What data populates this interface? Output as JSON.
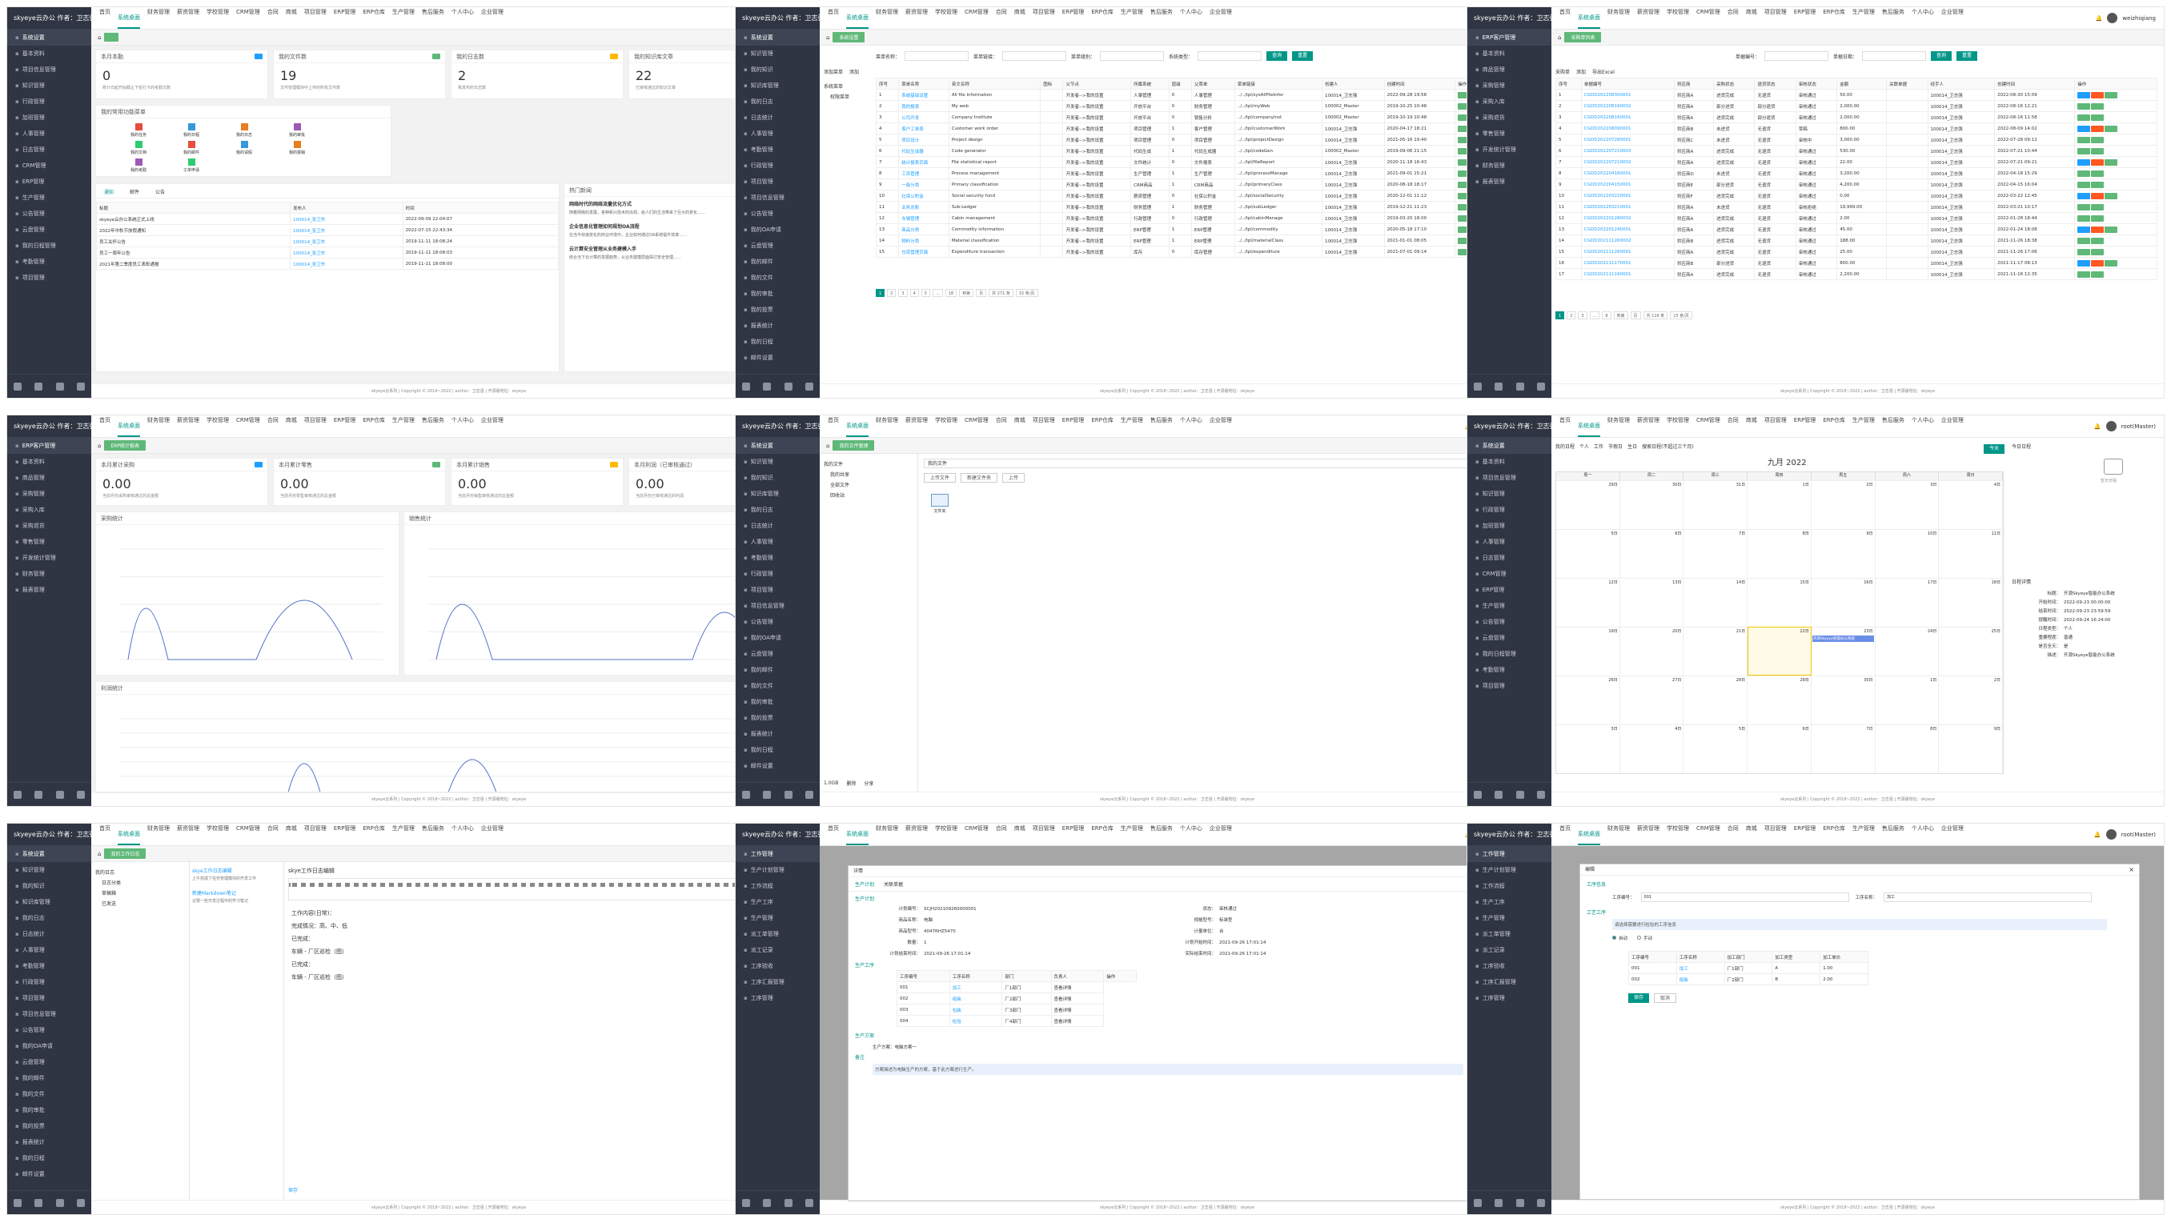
{
  "app": {
    "logo": "skyeye云办公 作者：卫志强",
    "username": "weizhiqiang",
    "username2": "root(Master)",
    "footer": "skyeye云系列 | Copyright © 2018~2022 | author：卫志强 | 开源版地址：skyeye"
  },
  "sidebar_nav": [
    "系统设置",
    "基本资料",
    "项目信息管理",
    "知识管理",
    "行政管理",
    "加班管理",
    "人事管理",
    "日志管理",
    "CRM管理",
    "ERP管理",
    "生产管理",
    "公告管理",
    "云盘管理",
    "我的日程管理",
    "考勤管理",
    "项目管理"
  ],
  "sidebar_erp": [
    "ERP客户管理",
    "基本资料",
    "商品管理",
    "采购管理",
    "采购入库",
    "采购退货",
    "零售管理",
    "开发统计管理",
    "财务管理",
    "报表管理"
  ],
  "sidebar_knowledge": [
    "系统设置",
    "知识管理",
    "我的知识",
    "知识库管理",
    "我的日志",
    "日志统计",
    "人事管理",
    "考勤管理",
    "行政管理",
    "项目管理",
    "项目信息管理",
    "公告管理",
    "我的OA申请",
    "云盘管理",
    "我的邮件",
    "我的文件",
    "我的审批",
    "我的投票",
    "报表统计",
    "我的日程",
    "邮件设置"
  ],
  "sidebar_prod": [
    "工作管理",
    "生产计划管理",
    "工作流程",
    "生产工序",
    "生产管理",
    "派工单管理",
    "派工记录",
    "工序验收",
    "工序汇报管理",
    "工序管理"
  ],
  "topnav": [
    "首页",
    "系统桌面",
    "财务管理",
    "薪资管理",
    "学校管理",
    "CRM管理",
    "合同",
    "商城",
    "项目管理",
    "ERP管理",
    "ERP仓库",
    "生产管理",
    "售后服务",
    "个人中心",
    "企业管理",
    "人事管理",
    "工作流"
  ],
  "p1": {
    "cards": [
      {
        "title": "本月本勤",
        "value": "0",
        "sub": "统计日起开始截止下班打卡的考勤次数"
      },
      {
        "title": "我的文件数",
        "value": "19",
        "sub": "文件管理模块中上传的所有文件数"
      },
      {
        "title": "我的日志数",
        "value": "2",
        "sub": "我发布的日志数"
      },
      {
        "title": "我的知识库文章",
        "value": "22",
        "sub": "已审核通过的知识文章"
      }
    ],
    "quick_title": "我的常用功能菜单",
    "quick": [
      "我的任务",
      "我的日程",
      "我的日志",
      "我的审批",
      "我的文档",
      "我的邮件",
      "我的请假",
      "我的报销",
      "我的考勤",
      "工单申请"
    ],
    "tabs": [
      "通知",
      "邮件",
      "公告"
    ],
    "news_header": [
      "标题",
      "发布人",
      "时间"
    ],
    "news": [
      [
        "skyeye云办公系统正式上线",
        "100014_张卫东",
        "2022-09-09 22:04:07"
      ],
      [
        "2022年中秋节放假通知",
        "100014_张卫东",
        "2022-07-15 22:43:34"
      ],
      [
        "员工关怀公告",
        "100014_张卫东",
        "2019-11-11 18:08:24"
      ],
      [
        "员工一周年公告",
        "100014_张卫东",
        "2019-11-11 18:08:03"
      ],
      [
        "2021年第二季度员工表彰通报",
        "100014_张卫东",
        "2019-11-11 18:08:00"
      ]
    ],
    "article_title": "热门新闻",
    "articles": [
      {
        "t": "网络时代的网络流量优化方式",
        "d": "随着网络的发展，各种新兴技术的出现，给人们的生活带来了巨大的变化……"
      },
      {
        "t": "企业信息化管理如何规划OA流程",
        "d": "在当今快速变化的商业环境中，企业如何通过OA系统提升效率……"
      },
      {
        "t": "云计算安全管理从业务建模入手",
        "d": "结合当下云计算的发展趋势，从业务建模层面探讨安全管理……"
      }
    ]
  },
  "p2": {
    "crumb": "系统设置",
    "search_labels": [
      "菜单名称：",
      "菜单链接：",
      "菜单级别：",
      "系统类型："
    ],
    "btn_search": "查询",
    "btn_reset": "重置",
    "tree": [
      "系统菜单",
      "权限菜单"
    ],
    "tools": [
      "添加菜单",
      "添加"
    ],
    "cols": [
      "序号",
      "菜单名称",
      "英文名称",
      "图标",
      "父节点",
      "所属系统",
      "层级",
      "父菜单",
      "菜单链接",
      "创建人",
      "创建时间",
      "操作"
    ],
    "rows": [
      [
        "1",
        "系统基础设置",
        "All file information",
        "",
        "开发者-->我的设置",
        "人事管理",
        "0",
        "人事管理",
        "../../tpl/sysAllFileInfor",
        "100014_卫志强",
        "2022-09-28 19:58"
      ],
      [
        "2",
        "我的报表",
        "My web",
        "",
        "开发者-->我的设置",
        "开放平台",
        "0",
        "财务管理",
        "../../tpl/myWeb",
        "100002_Master",
        "2019-10-25 10:48"
      ],
      [
        "3",
        "公司开发",
        "Company Institute",
        "",
        "开发者-->我的设置",
        "开放平台",
        "0",
        "销售分析",
        "../../tpl/companyInst",
        "100002_Master",
        "2019-10-19 10:48"
      ],
      [
        "4",
        "客户工单表",
        "Customer work order",
        "",
        "开发者-->我的设置",
        "项目管理",
        "1",
        "客户管理",
        "../../tpl/customerWork",
        "100014_卫志强",
        "2020-04-17 18:21"
      ],
      [
        "5",
        "项目设计",
        "Project design",
        "",
        "开发者-->我的设置",
        "项目管理",
        "0",
        "项目管理",
        "../../tpl/projectDesign",
        "100014_卫志强",
        "2021-05-16 19:40"
      ],
      [
        "6",
        "代码生成器",
        "Code generator",
        "",
        "开发者-->我的设置",
        "代码生成",
        "1",
        "代码生成器",
        "../../tpl/codeGen",
        "100002_Master",
        "2019-09-06 21:15"
      ],
      [
        "7",
        "统计报表页面",
        "File statistical report",
        "",
        "开发者-->我的设置",
        "文件统计",
        "0",
        "文件报表",
        "../../tpl/fileReport",
        "100014_卫志强",
        "2020-11-18 16:43"
      ],
      [
        "8",
        "工序管理",
        "Process management",
        "",
        "开发者-->我的设置",
        "生产管理",
        "1",
        "生产管理",
        "../../tpl/processManage",
        "100014_卫志强",
        "2021-09-01 15:21"
      ],
      [
        "9",
        "一级分类",
        "Primary classification",
        "",
        "开发者-->我的设置",
        "CRM商品",
        "1",
        "CRM商品",
        "../../tpl/primaryClass",
        "100014_卫志强",
        "2020-08-18 18:17"
      ],
      [
        "10",
        "社保公积金",
        "Social security fund",
        "",
        "开发者-->我的设置",
        "薪资管理",
        "0",
        "社保公积金",
        "../../tpl/socialSecurity",
        "100014_卫志强",
        "2020-12-01 11:12"
      ],
      [
        "11",
        "业务总账",
        "Sub-Ledger",
        "",
        "开发者-->我的设置",
        "财务管理",
        "1",
        "财务管理",
        "../../tpl/subLedger",
        "100014_卫志强",
        "2019-12-21 11:23"
      ],
      [
        "12",
        "车辆管理",
        "Cabin management",
        "",
        "开发者-->我的设置",
        "行政管理",
        "0",
        "行政管理",
        "../../tpl/cabinManage",
        "100014_卫志强",
        "2019-03-20 18:00"
      ],
      [
        "13",
        "商品分类",
        "Commodity information",
        "",
        "开发者-->我的设置",
        "ERP管理",
        "1",
        "ERP管理",
        "../../tpl/commodity",
        "100014_卫志强",
        "2020-05-18 17:10"
      ],
      [
        "14",
        "物料分类",
        "Material classification",
        "",
        "开发者-->我的设置",
        "ERP管理",
        "1",
        "ERP管理",
        "../../tpl/materialClass",
        "100014_卫志强",
        "2021-01-01 08:05"
      ],
      [
        "15",
        "仓库管理页面",
        "Expenditure transaction",
        "",
        "开发者-->我的设置",
        "库存",
        "0",
        "库存管理",
        "../../tpl/expenditure",
        "100014_卫志强",
        "2021-07-01 09:14"
      ]
    ],
    "pager": [
      "1",
      "2",
      "3",
      "4",
      "5",
      "...",
      "18",
      "到第",
      "页",
      "共 271 条",
      "15 条/页"
    ]
  },
  "p3": {
    "crumb": "采购单列表",
    "search_labels": [
      "单据编号：",
      "单据日期："
    ],
    "btn_search": "查询",
    "btn_reset": "重置",
    "tools": [
      "采购单",
      "添加",
      "导出Excel"
    ],
    "cols": [
      "序号",
      "单据编号",
      "供应商",
      "采购状态",
      "退货状态",
      "审核状态",
      "金额",
      "关联单据",
      "经手人",
      "创建时间",
      "操作"
    ],
    "rows": [
      [
        "1",
        "CGDD202208300001",
        "供应商A",
        "进货完成",
        "无退货",
        "审核通过",
        "50.00",
        "",
        "100014_卫志强",
        "2022-08-30 15:09"
      ],
      [
        "2",
        "CGDD202208160002",
        "供应商A",
        "部分进货",
        "部分退货",
        "审核通过",
        "2,000.00",
        "",
        "100014_卫志强",
        "2022-08-16 12:21"
      ],
      [
        "3",
        "CGDD202208160001",
        "供应商A",
        "进货完成",
        "部分退货",
        "审核通过",
        "2,000.00",
        "",
        "100014_卫志强",
        "2022-08-16 11:58"
      ],
      [
        "4",
        "CGDD202208090001",
        "供应商B",
        "未进货",
        "无退货",
        "草稿",
        "800.00",
        "",
        "100014_卫志强",
        "2022-08-09 14:02"
      ],
      [
        "5",
        "CGDD202207280001",
        "供应商C",
        "未进货",
        "无退货",
        "审核中",
        "3,000.00",
        "",
        "100014_卫志强",
        "2022-07-28 09:12"
      ],
      [
        "6",
        "CGDD202207210003",
        "供应商A",
        "进货完成",
        "无退货",
        "审核通过",
        "530.00",
        "",
        "100014_卫志强",
        "2022-07-21 10:44"
      ],
      [
        "7",
        "CGDD202207210002",
        "供应商A",
        "进货完成",
        "无退货",
        "审核通过",
        "22.00",
        "",
        "100014_卫志强",
        "2022-07-21 09:21"
      ],
      [
        "8",
        "CGDD202204180001",
        "供应商D",
        "未进货",
        "无退货",
        "审核通过",
        "3,200.00",
        "",
        "100014_卫志强",
        "2022-04-18 15:29"
      ],
      [
        "9",
        "CGDD202204150001",
        "供应商E",
        "部分进货",
        "无退货",
        "审核通过",
        "4,200.00",
        "",
        "100014_卫志强",
        "2022-04-15 16:04"
      ],
      [
        "10",
        "CGDD202203220001",
        "供应商F",
        "进货完成",
        "无退货",
        "审核通过",
        "0.00",
        "",
        "100014_卫志强",
        "2022-03-22 12:45"
      ],
      [
        "11",
        "CGDD202203210001",
        "供应商A",
        "未进货",
        "无退货",
        "审核拒绝",
        "19,999.00",
        "",
        "100014_卫志强",
        "2022-03-21 10:17"
      ],
      [
        "12",
        "CGDD202201280002",
        "供应商A",
        "进货完成",
        "无退货",
        "审核通过",
        "2.00",
        "",
        "100014_卫志强",
        "2022-01-28 18:44"
      ],
      [
        "13",
        "CGDD202201240001",
        "供应商A",
        "进货完成",
        "无退货",
        "审核通过",
        "45.00",
        "",
        "100014_卫志强",
        "2022-01-24 18:08"
      ],
      [
        "14",
        "CGDD202111260002",
        "供应商B",
        "进货完成",
        "无退货",
        "审核通过",
        "188.00",
        "",
        "100014_卫志强",
        "2021-11-26 18:38"
      ],
      [
        "15",
        "CGDD202111260001",
        "供应商A",
        "进货完成",
        "无退货",
        "审核通过",
        "25.00",
        "",
        "100014_卫志强",
        "2021-11-26 17:06"
      ],
      [
        "16",
        "CGDD202111170001",
        "供应商B",
        "部分进货",
        "无退货",
        "审核通过",
        "800.00",
        "",
        "100014_卫志强",
        "2021-11-17 08:13"
      ],
      [
        "17",
        "CGDD202111160001",
        "供应商A",
        "进货完成",
        "无退货",
        "审核通过",
        "2,200.00",
        "",
        "100014_卫志强",
        "2021-11-16 12:35"
      ]
    ],
    "pager": [
      "1",
      "2",
      "3",
      "...",
      "8",
      "到第",
      "页",
      "共 116 条",
      "15 条/页"
    ]
  },
  "p4": {
    "crumb": "ERP统计报表",
    "cards": [
      {
        "title": "本月累计采购",
        "value": "0.00",
        "sub": "当前月份采购审核通过的总金额"
      },
      {
        "title": "本月累计零售",
        "value": "0.00",
        "sub": "当前月份零售审核通过的总金额"
      },
      {
        "title": "本月累计销售",
        "value": "0.00",
        "sub": "当前月份销售审核通过的总金额"
      },
      {
        "title": "本月利润（已审核通过）",
        "value": "0.00",
        "sub": "当前月份已审核通过的利润"
      }
    ],
    "chart_titles": [
      "采购统计",
      "销售统计",
      "利润统计"
    ],
    "chart3_title": "近十二个月的利润（已审核通过）"
  },
  "p5": {
    "crumb": "我的文件管理",
    "tree": [
      "我的文件",
      "我的共享",
      "全部文件",
      "回收站"
    ],
    "path": "我的文件",
    "tools": [
      "上传文件",
      "新建文件夹",
      "上传"
    ],
    "file": "文件夹",
    "foot": [
      "1.0GB",
      "删除",
      "分享"
    ]
  },
  "p6": {
    "filters": [
      "我的日程",
      "个人",
      "工作",
      "节假日",
      "生日",
      "搜索日程(不超过三个月)"
    ],
    "title": "九月 2022",
    "weekdays": [
      "周一",
      "周二",
      "周三",
      "周四",
      "周五",
      "周六",
      "周日"
    ],
    "today_btn": "今天",
    "detail_title": "日程详情",
    "detail": [
      [
        "标题：",
        "开源Skyeye智能办公系统"
      ],
      [
        "开始时间：",
        "2022-09-23 00:00:00"
      ],
      [
        "结束时间：",
        "2022-09-23 23:59:59"
      ],
      [
        "提醒时间：",
        "2022-09-24 16:24:00"
      ],
      [
        "日程类型：",
        "个人"
      ],
      [
        "重要程度：",
        "普通"
      ],
      [
        "是否全天：",
        "是"
      ],
      [
        "描述：",
        "开源Skyeye智能办公系统"
      ]
    ],
    "today_label": "今日日程",
    "empty": "暂无日程",
    "event": "开源Skyeye智能办公系统"
  },
  "p7": {
    "crumb": "我的工作日志",
    "tree": [
      "我的日志",
      "日志分类",
      "草稿箱",
      "已发送"
    ],
    "notes": [
      {
        "t": "skye工作日志编辑",
        "d": "上午完成了任务管理模块的开发工作"
      },
      {
        "t": "新建Markdown笔记",
        "d": "记录一些开发过程中的学习笔记"
      }
    ],
    "editor_title": "skye工作日志编辑",
    "body": [
      "工作内容(日常)：",
      "完成情况：高、中、低",
      "已完成：",
      "车辆 - 厂区巡检（图）",
      "已完成：",
      "车辆 - 厂区巡检（图）"
    ],
    "save": "保存"
  },
  "p8": {
    "title": "详情",
    "tabs": [
      "生产计划",
      "关联单据"
    ],
    "section": "生产计划",
    "fields": [
      [
        "计划编号：",
        "SCJH202109260000001"
      ],
      [
        "状态：",
        "审核通过"
      ],
      [
        "商品名称：",
        "电脑"
      ],
      [
        "规格型号：",
        "标准型"
      ],
      [
        "商品型号：",
        "4047RHZ5470"
      ],
      [
        "计量单位：",
        "台"
      ],
      [
        "数量：",
        "1"
      ],
      [
        "计划开始时间：",
        "2021-09-26 17:01:14"
      ],
      [
        "计划结束时间：",
        "2021-09-26 17:01:14"
      ],
      [
        "实际结束时间：",
        "2021-09-26 17:01:14"
      ]
    ],
    "sub": "生产工序",
    "sub_cols": [
      "工序编号",
      "工序名称",
      "部门",
      "负责人",
      "操作"
    ],
    "sub_rows": [
      [
        "001",
        "加工",
        "厂1部门",
        "查看详情"
      ],
      [
        "002",
        "组装",
        "厂2部门",
        "查看详情"
      ],
      [
        "003",
        "包装",
        "厂3部门",
        "查看详情"
      ],
      [
        "004",
        "检验",
        "厂4部门",
        "查看详情"
      ]
    ],
    "sec2": "生产方案",
    "plan_label": "生产方案：",
    "plan_value": "电脑方案一",
    "sec3": "备注",
    "rem": "方案描述为电脑生产的方案，基于此方案进行生产。"
  },
  "p9": {
    "title": "编辑",
    "sec": "工序信息",
    "f1": [
      "工序编号：",
      "001",
      "工序名称：",
      "加工"
    ],
    "sec2": "工艺工序",
    "bar": "请选择需要进行检验的工序信息",
    "radio": [
      "自动",
      "手动"
    ],
    "cols": [
      "工序编号",
      "工序名称",
      "加工部门",
      "加工类型",
      "加工单价"
    ],
    "rows": [
      [
        "001",
        "加工",
        "厂1部门",
        "A",
        "1.00"
      ],
      [
        "002",
        "组装",
        "厂2部门",
        "B",
        "2.00"
      ]
    ],
    "btns": [
      "保存",
      "取消"
    ]
  }
}
